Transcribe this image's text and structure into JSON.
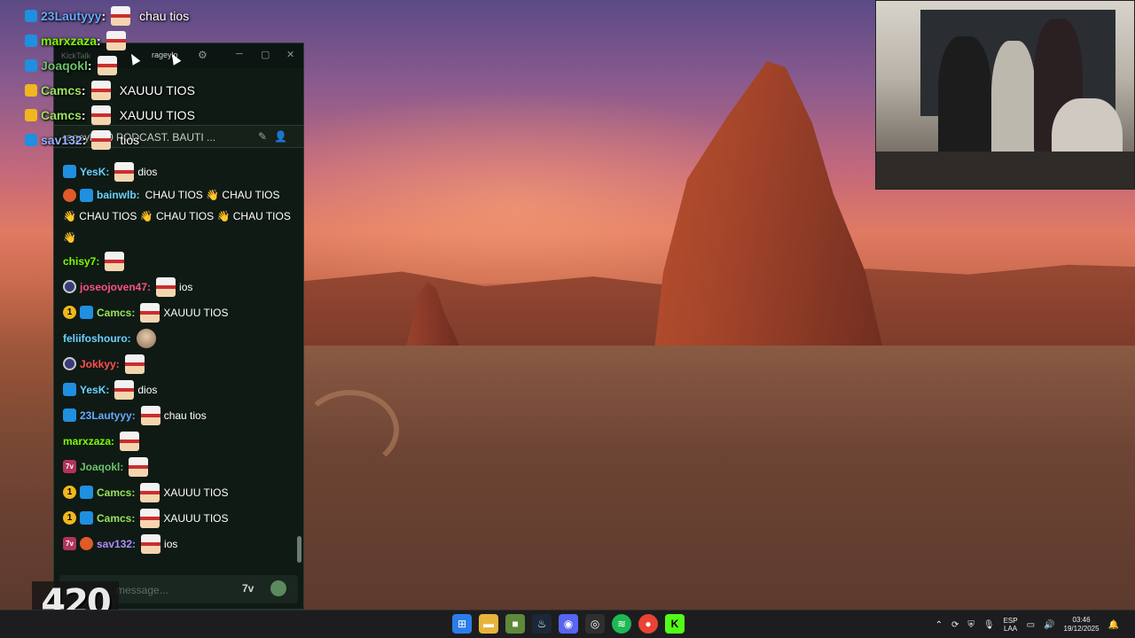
{
  "overlay_chat": [
    {
      "user": "23Lautyyy",
      "color": "#6aa8ff",
      "message": "chau tios"
    },
    {
      "user": "marxzaza",
      "color": "#7cfc00",
      "message": ""
    },
    {
      "user": "Joaqokl",
      "color": "#6ac36a",
      "message": ""
    },
    {
      "user": "Camcs",
      "color": "#9be15d",
      "message": "XAUUU TIOS"
    },
    {
      "user": "Camcs",
      "color": "#9be15d",
      "message": "XAUUU TIOS"
    },
    {
      "user": "sav132",
      "color": "#9ab0ff",
      "message": "tios"
    }
  ],
  "kicktalk": {
    "app_name": "KickTalk",
    "tab_user": "rageylo",
    "stream_title": "rageylo · 0 PODCAST. BAUTI ...",
    "input_placeholder": "message...",
    "input_7tv": "7v",
    "messages": [
      {
        "user": "YesK",
        "color": "#6ad0ff",
        "text": "dios",
        "badges": [
          "blue"
        ]
      },
      {
        "user": "bainwlb",
        "color": "#6ad0ff",
        "text": "CHAU TIOS 👋 CHAU TIOS 👋 CHAU TIOS 👋 CHAU TIOS 👋 CHAU TIOS 👋",
        "badges": [
          "pin",
          "blue"
        ]
      },
      {
        "user": "chisy7",
        "color": "#7cfc00",
        "text": "",
        "badges": []
      },
      {
        "user": "joseojoven47",
        "color": "#ff4f8a",
        "text": "ios",
        "badges": [
          "circle"
        ]
      },
      {
        "user": "Camcs",
        "color": "#9be15d",
        "text": "XAUUU TIOS",
        "badges": [
          "gold",
          "blue"
        ]
      },
      {
        "user": "feliifoshouro",
        "color": "#6ad0ff",
        "text": "",
        "badges": []
      },
      {
        "user": "Jokkyy",
        "color": "#ff4f4f",
        "text": "",
        "badges": [
          "circle"
        ]
      },
      {
        "user": "YesK",
        "color": "#6ad0ff",
        "text": "dios",
        "badges": [
          "blue"
        ]
      },
      {
        "user": "23Lautyyy",
        "color": "#6aa8ff",
        "text": "chau tios",
        "badges": [
          "blue"
        ]
      },
      {
        "user": "marxzaza",
        "color": "#7cfc00",
        "text": "",
        "badges": []
      },
      {
        "user": "Joaqokl",
        "color": "#6ac36a",
        "text": "",
        "badges": [
          "seven"
        ]
      },
      {
        "user": "Camcs",
        "color": "#9be15d",
        "text": "XAUUU TIOS",
        "badges": [
          "gold",
          "blue"
        ]
      },
      {
        "user": "Camcs",
        "color": "#9be15d",
        "text": "XAUUU TIOS",
        "badges": [
          "gold",
          "blue"
        ]
      },
      {
        "user": "sav132",
        "color": "#b08cff",
        "text": "ios",
        "badges": [
          "seven",
          "pin"
        ]
      }
    ]
  },
  "logo_text": "420",
  "taskbar": {
    "apps": [
      "windows-start",
      "file-explorer",
      "minecraft",
      "steam",
      "discord",
      "obs",
      "spotify",
      "chrome",
      "kick"
    ],
    "lang_line1": "ESP",
    "lang_line2": "LAA",
    "time": "03:46",
    "date": "19/12/2025"
  }
}
